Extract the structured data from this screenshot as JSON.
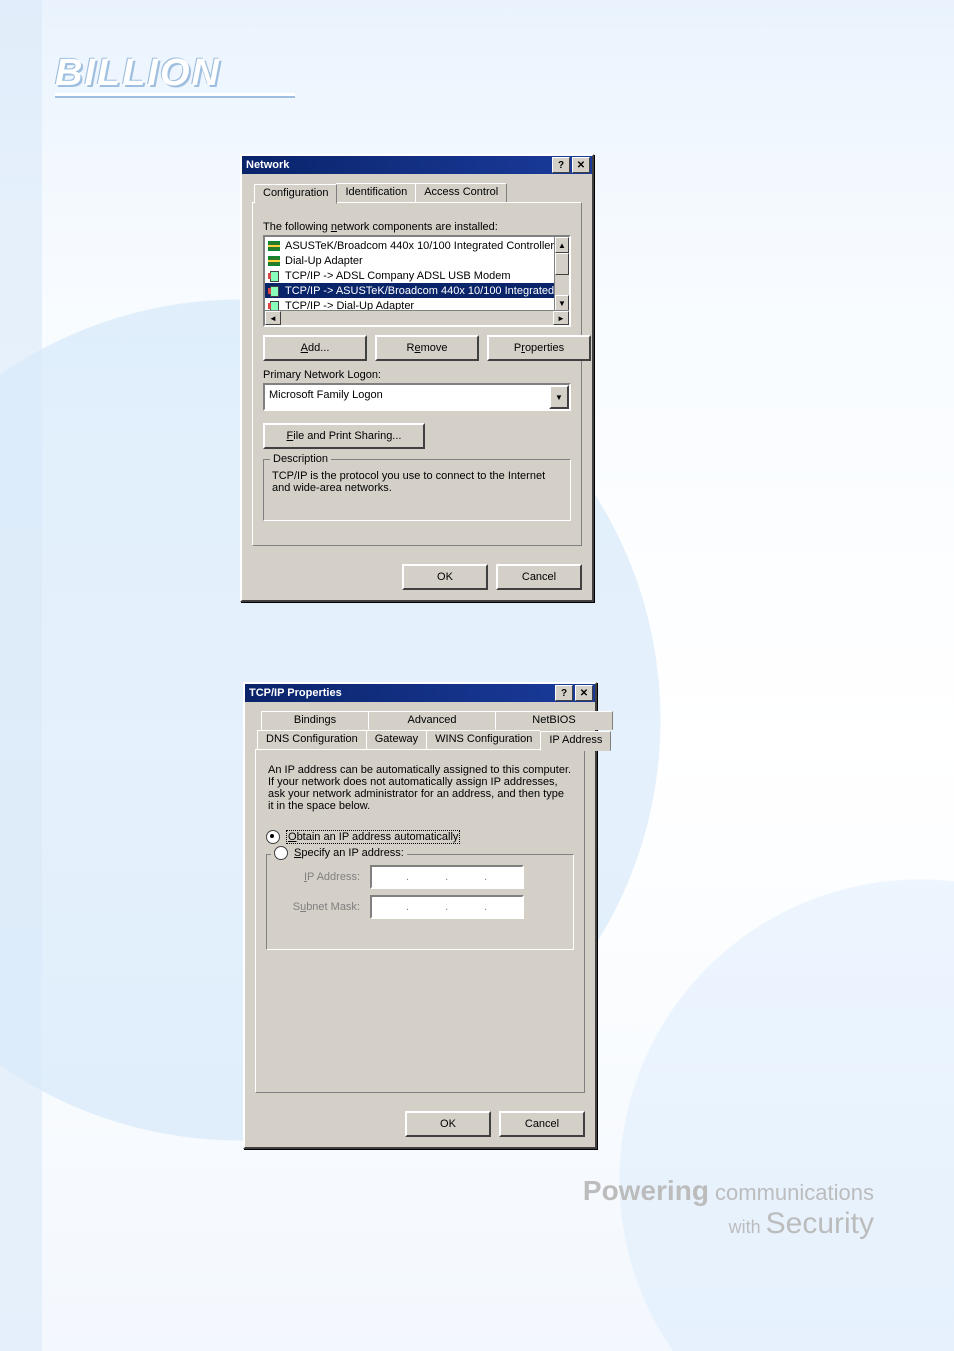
{
  "branding": {
    "logo_text": "BILLION",
    "tagline_strong": "Powering",
    "tagline_light": " communications",
    "tagline_with": "with ",
    "tagline_security": "Security"
  },
  "network_dialog": {
    "title": "Network",
    "help_btn": "?",
    "close_btn": "✕",
    "tabs": [
      "Configuration",
      "Identification",
      "Access Control"
    ],
    "active_tab": 0,
    "components_label": "The following network components are installed:",
    "components": [
      {
        "icon": "card",
        "text": "ASUSTeK/Broadcom 440x 10/100 Integrated Controller",
        "selected": false
      },
      {
        "icon": "card",
        "text": "Dial-Up Adapter",
        "selected": false
      },
      {
        "icon": "proto",
        "text": "TCP/IP -> ADSL Company ADSL USB Modem",
        "selected": false
      },
      {
        "icon": "proto",
        "text": "TCP/IP -> ASUSTeK/Broadcom 440x 10/100 Integrated",
        "selected": true
      },
      {
        "icon": "proto",
        "text": "TCP/IP -> Dial-Up Adapter",
        "selected": false
      }
    ],
    "btn_add": "Add...",
    "btn_remove": "Remove",
    "btn_properties": "Properties",
    "logon_label": "Primary Network Logon:",
    "logon_value": "Microsoft Family Logon",
    "btn_file_print": "File and Print Sharing...",
    "description_legend": "Description",
    "description_text": "TCP/IP is the protocol you use to connect to the Internet and wide-area networks.",
    "ok": "OK",
    "cancel": "Cancel"
  },
  "tcpip_dialog": {
    "title": "TCP/IP Properties",
    "help_btn": "?",
    "close_btn": "✕",
    "tabs_row1": [
      "Bindings",
      "Advanced",
      "NetBIOS"
    ],
    "tabs_row2": [
      "DNS Configuration",
      "Gateway",
      "WINS Configuration",
      "IP Address"
    ],
    "active_tab_row": 2,
    "active_tab_index": 3,
    "intro_text": "An IP address can be automatically assigned to this computer. If your network does not automatically assign IP addresses, ask your network administrator for an address, and then type it in the space below.",
    "radio_auto": "Obtain an IP address automatically",
    "radio_specify": "Specify an IP address:",
    "radio_selected": "auto",
    "ip_label": "IP Address:",
    "mask_label": "Subnet Mask:",
    "ok": "OK",
    "cancel": "Cancel"
  }
}
